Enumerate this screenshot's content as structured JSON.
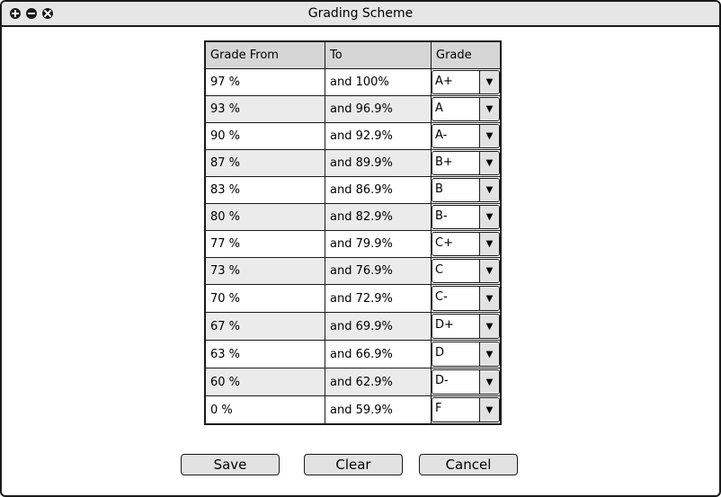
{
  "window": {
    "title": "Grading Scheme"
  },
  "table": {
    "headers": {
      "from": "Grade From",
      "to": "To",
      "grade": "Grade"
    },
    "rows": [
      {
        "from": "97 %",
        "to": "and 100%",
        "grade": "A+"
      },
      {
        "from": "93 %",
        "to": "and 96.9%",
        "grade": "A"
      },
      {
        "from": "90 %",
        "to": "and 92.9%",
        "grade": "A-"
      },
      {
        "from": "87 %",
        "to": "and 89.9%",
        "grade": "B+"
      },
      {
        "from": "83 %",
        "to": "and 86.9%",
        "grade": "B"
      },
      {
        "from": "80 %",
        "to": "and 82.9%",
        "grade": "B-"
      },
      {
        "from": "77 %",
        "to": "and 79.9%",
        "grade": "C+"
      },
      {
        "from": "73 %",
        "to": "and 76.9%",
        "grade": "C"
      },
      {
        "from": "70 %",
        "to": "and 72.9%",
        "grade": "C-"
      },
      {
        "from": "67 %",
        "to": "and 69.9%",
        "grade": "D+"
      },
      {
        "from": "63 %",
        "to": "and 66.9%",
        "grade": "D"
      },
      {
        "from": "60 %",
        "to": "and 62.9%",
        "grade": "D-"
      },
      {
        "from": "0 %",
        "to": "and 59.9%",
        "grade": "F"
      }
    ],
    "dropdown_arrow": "▼"
  },
  "buttons": {
    "save": "Save",
    "clear": "Clear",
    "cancel": "Cancel"
  }
}
